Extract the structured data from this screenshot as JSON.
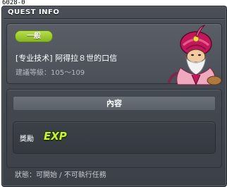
{
  "quest_id": "6028-0",
  "window": {
    "title": "QUEST INFO"
  },
  "quest": {
    "category_badge": "一般",
    "name": "[专业技术] 阿得拉８世的口信",
    "recommended_level": "建議等級：105～109"
  },
  "content": {
    "header": "內容",
    "reward_label": "獎勵",
    "reward_icon": "exp-icon",
    "reward_icon_text": "EXP"
  },
  "status": "狀態：可開始 / 不可執行任務",
  "colors": {
    "badge_green": "#9acb33",
    "exp_green": "#c8f03a",
    "panel_bg": "#4b5058"
  }
}
